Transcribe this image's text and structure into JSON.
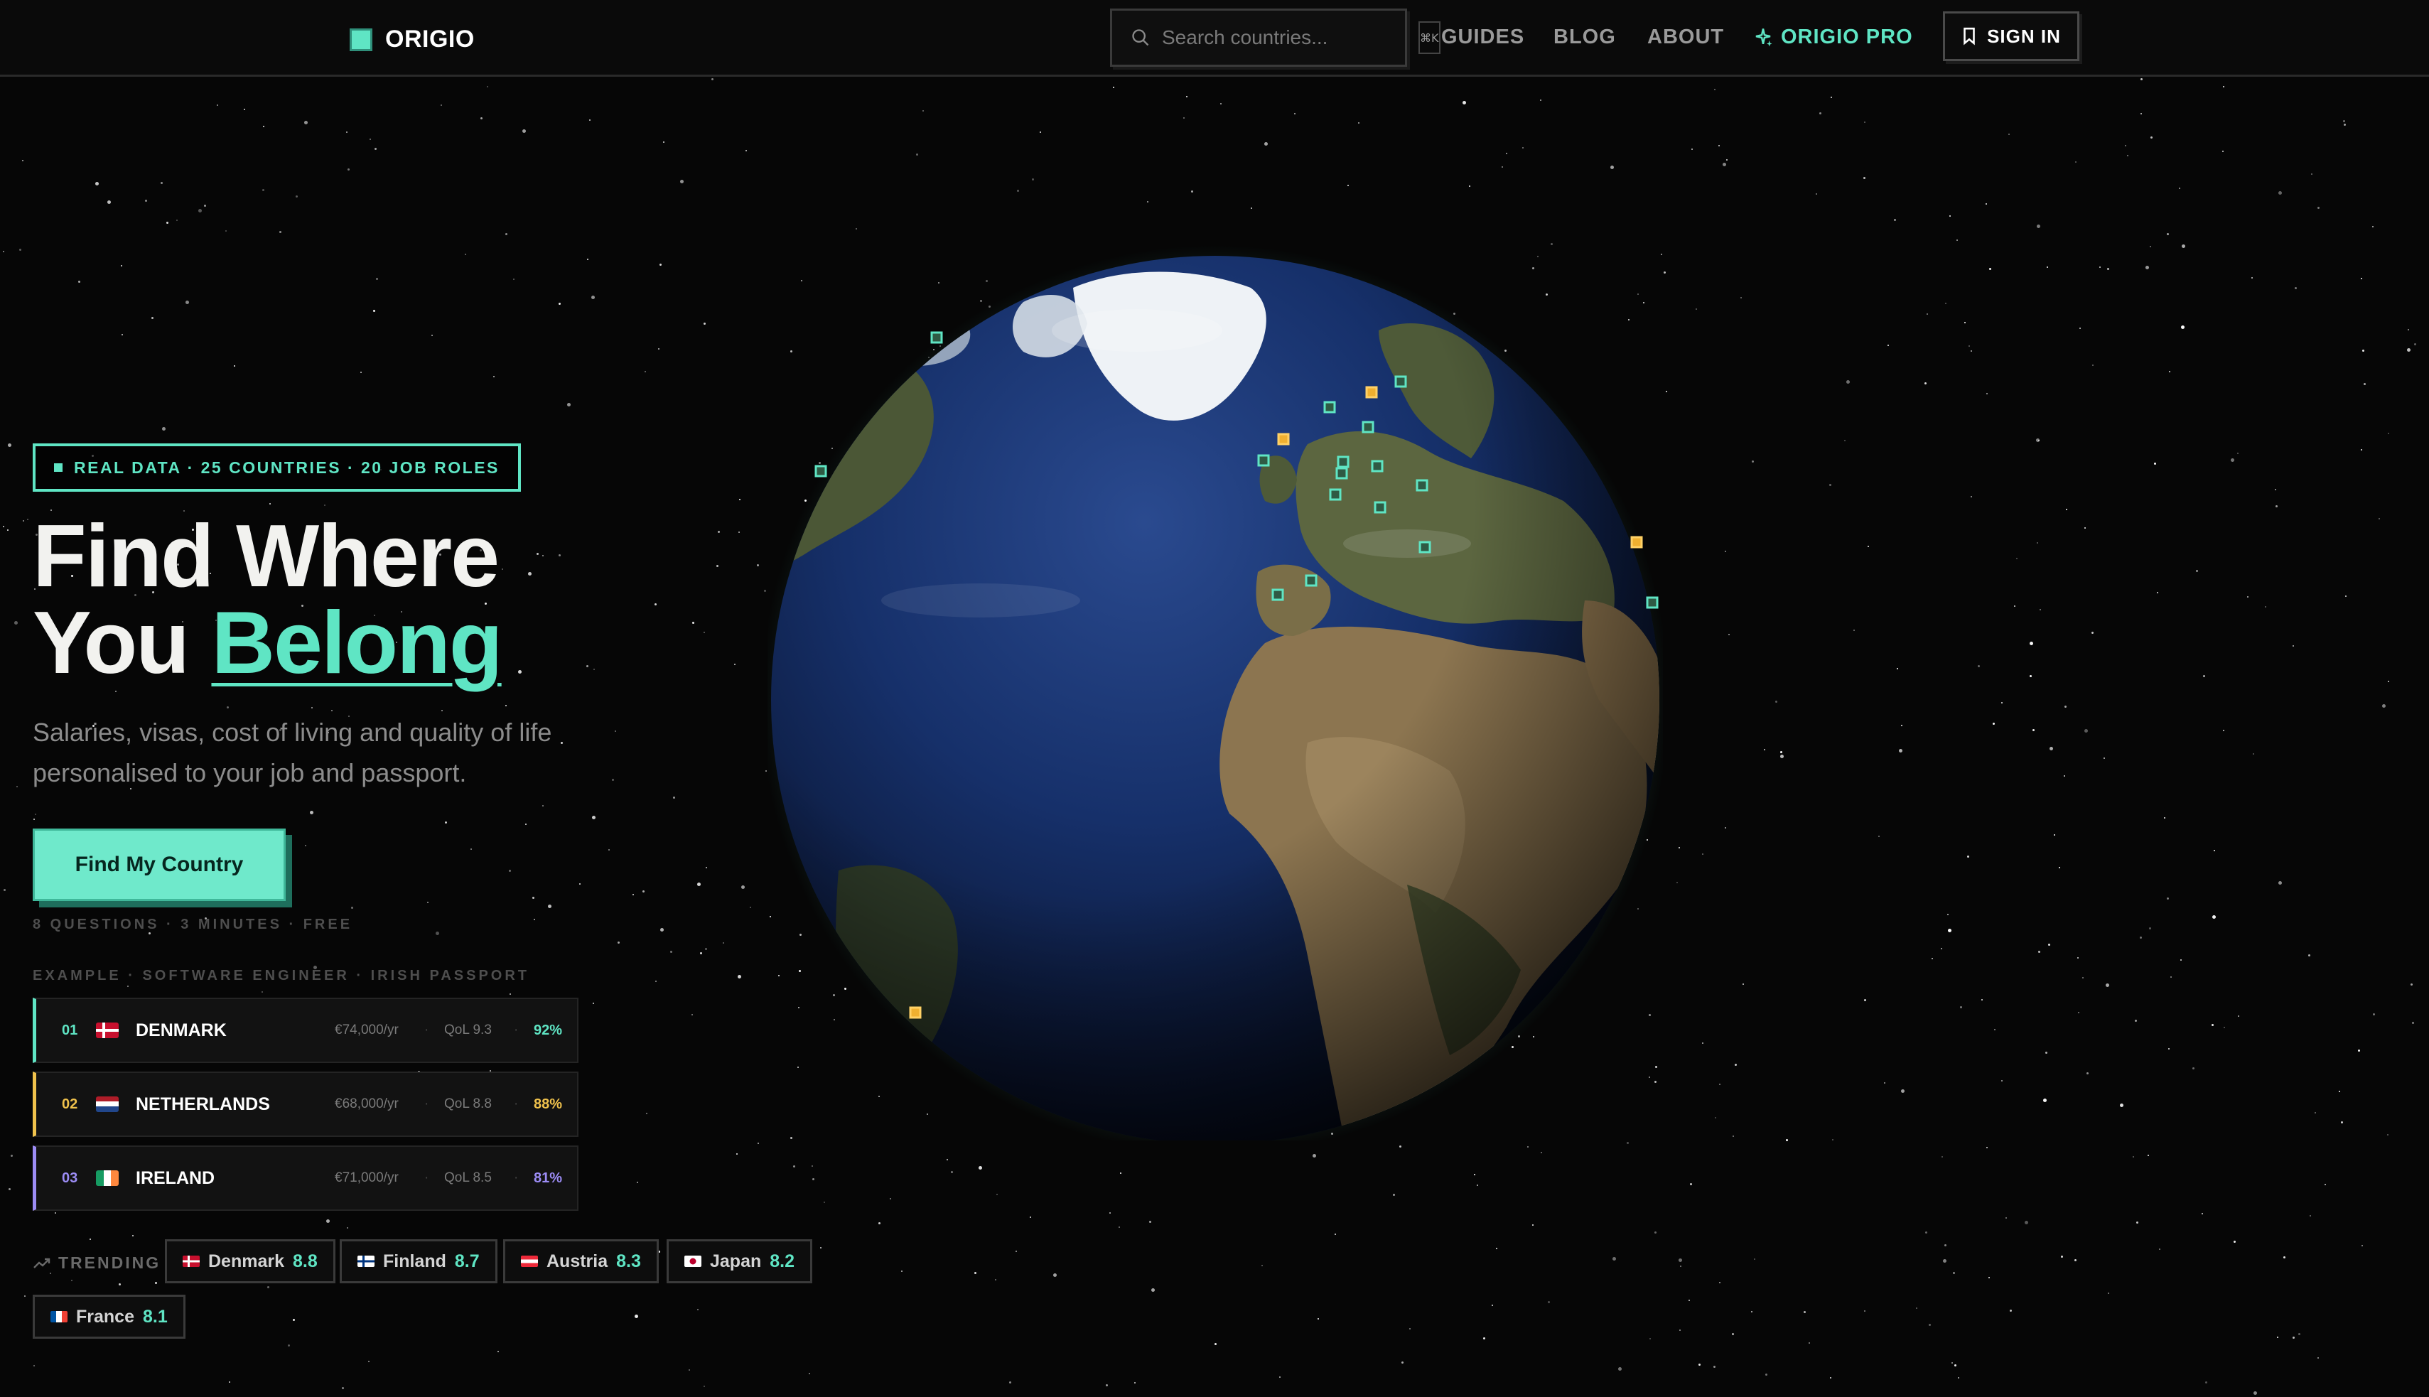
{
  "nav": {
    "logo": "ORIGIO",
    "search_placeholder": "Search countries...",
    "search_kbd": "⌘K",
    "links": [
      "GUIDES",
      "BLOG",
      "ABOUT"
    ],
    "pro_label": "ORIGIO PRO",
    "signin_label": "SIGN IN"
  },
  "hero": {
    "pill": "REAL DATA · 25 COUNTRIES · 20 JOB ROLES",
    "title_line1": "Find Where",
    "title_line2_prefix": "You ",
    "title_accent": "Belong",
    "subtitle": "Salaries, visas, cost of living and quality of life personalised to your job and passport.",
    "cta_label": "Find My Country",
    "cta_meta": "8 QUESTIONS · 3 MINUTES · FREE",
    "example_label": "EXAMPLE · SOFTWARE ENGINEER · IRISH PASSPORT"
  },
  "results": [
    {
      "rank": "01",
      "country": "DENMARK",
      "salary": "€74,000/yr",
      "qol": "QoL 9.3",
      "match": "92%",
      "color": "#5fe5c4",
      "flag": "dk-flag-icon"
    },
    {
      "rank": "02",
      "country": "NETHERLANDS",
      "salary": "€68,000/yr",
      "qol": "QoL 8.8",
      "match": "88%",
      "color": "#f0c24c",
      "flag": "nl-flag-icon"
    },
    {
      "rank": "03",
      "country": "IRELAND",
      "salary": "€71,000/yr",
      "qol": "QoL 8.5",
      "match": "81%",
      "color": "#9c8cf5",
      "flag": "ie-flag-icon"
    }
  ],
  "trending": {
    "label": "TRENDING",
    "items": [
      {
        "name": "Denmark",
        "score": "8.8",
        "flag": "dk-flag-icon"
      },
      {
        "name": "Finland",
        "score": "8.7",
        "flag": "fi-flag-icon"
      },
      {
        "name": "Austria",
        "score": "8.3",
        "flag": "at-flag-icon"
      },
      {
        "name": "Japan",
        "score": "8.2",
        "flag": "jp-flag-icon"
      },
      {
        "name": "France",
        "score": "8.1",
        "flag": "fr-flag-icon"
      }
    ]
  },
  "colors": {
    "accent": "#5fe5c4",
    "background": "#060606",
    "marker_gold": "#f0b030"
  }
}
